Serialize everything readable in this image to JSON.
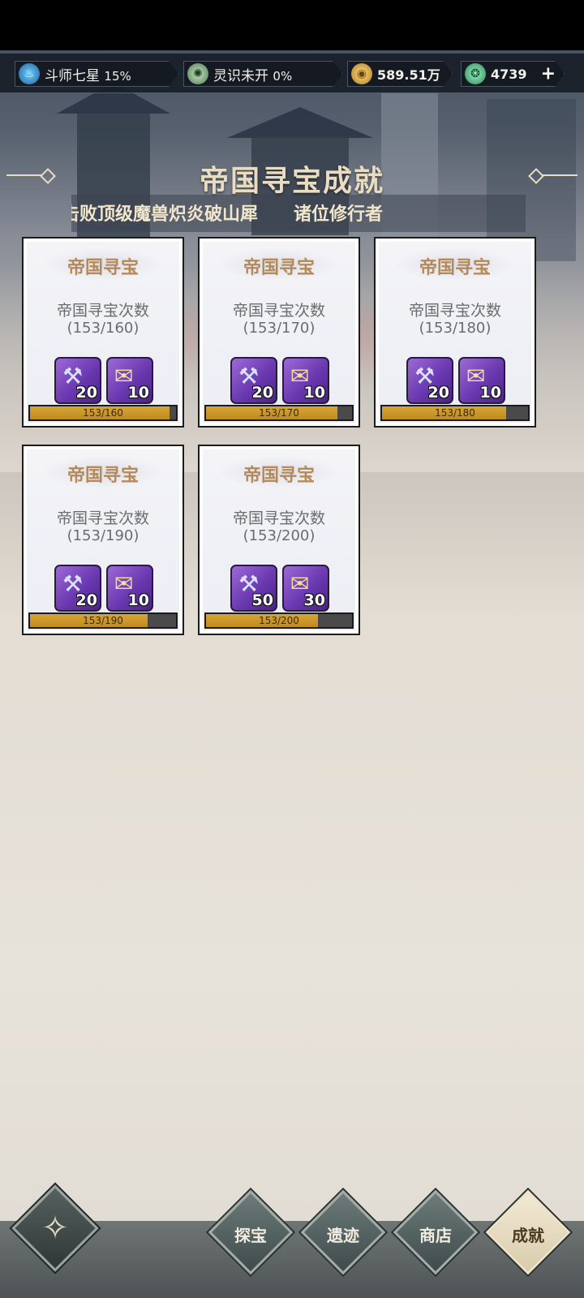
{
  "resources": [
    {
      "icon": "blue-flame-icon",
      "label": "斗师七星",
      "value": "15%"
    },
    {
      "icon": "spirit-swirl-icon",
      "label": "灵识未开",
      "value": "0%"
    },
    {
      "icon": "gold-coin-icon",
      "label": "",
      "value": "589.51万"
    },
    {
      "icon": "green-jade-icon",
      "label": "",
      "value": "4739",
      "action": "+"
    }
  ],
  "header": {
    "title": "帝国寻宝成就",
    "ticker": "击败顶级魔兽炽炎破山犀　　诸位修行者"
  },
  "cards": [
    {
      "title": "帝国寻宝",
      "desc": "帝国寻宝次数",
      "count": "(153/160)",
      "progress_text": "153/160",
      "progress": 0.956,
      "rewards": [
        {
          "icon": "drill-icon",
          "qty": "20"
        },
        {
          "icon": "scroll-icon",
          "qty": "10"
        }
      ]
    },
    {
      "title": "帝国寻宝",
      "desc": "帝国寻宝次数",
      "count": "(153/170)",
      "progress_text": "153/170",
      "progress": 0.9,
      "rewards": [
        {
          "icon": "drill-icon",
          "qty": "20"
        },
        {
          "icon": "scroll-icon",
          "qty": "10"
        }
      ]
    },
    {
      "title": "帝国寻宝",
      "desc": "帝国寻宝次数",
      "count": "(153/180)",
      "progress_text": "153/180",
      "progress": 0.85,
      "rewards": [
        {
          "icon": "drill-icon",
          "qty": "20"
        },
        {
          "icon": "scroll-icon",
          "qty": "10"
        }
      ]
    },
    {
      "title": "帝国寻宝",
      "desc": "帝国寻宝次数",
      "count": "(153/190)",
      "progress_text": "153/190",
      "progress": 0.805,
      "rewards": [
        {
          "icon": "drill-icon",
          "qty": "20"
        },
        {
          "icon": "scroll-icon",
          "qty": "10"
        }
      ]
    },
    {
      "title": "帝国寻宝",
      "desc": "帝国寻宝次数",
      "count": "(153/200)",
      "progress_text": "153/200",
      "progress": 0.765,
      "rewards": [
        {
          "icon": "drill-icon",
          "qty": "50"
        },
        {
          "icon": "scroll-icon",
          "qty": "30"
        }
      ]
    }
  ],
  "nav": {
    "home_icon": "emblem-icon",
    "tabs": [
      {
        "label": "探宝",
        "active": false
      },
      {
        "label": "遗迹",
        "active": false
      },
      {
        "label": "商店",
        "active": false
      },
      {
        "label": "成就",
        "active": true
      }
    ]
  },
  "colors": {
    "accent_gold": "#c08a20",
    "card_title": "#b48a5a",
    "reward_purple": "#6a38b0"
  }
}
